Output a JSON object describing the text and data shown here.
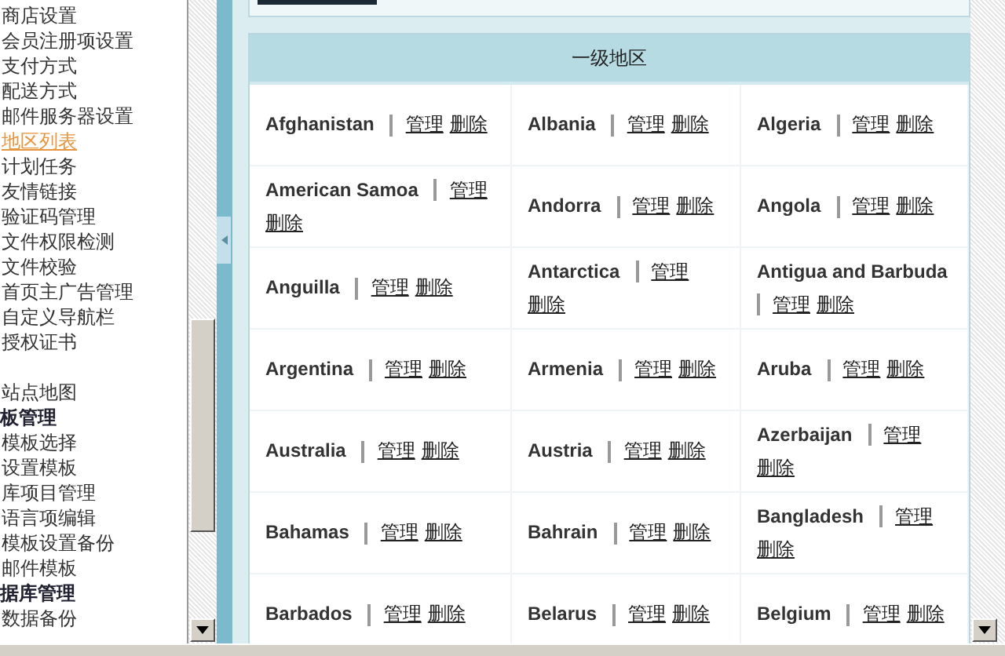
{
  "sidebar": {
    "sections": [
      {
        "items": [
          {
            "label": "商店设置",
            "selected": false
          },
          {
            "label": "会员注册项设置",
            "selected": false
          },
          {
            "label": "支付方式",
            "selected": false
          },
          {
            "label": "配送方式",
            "selected": false
          },
          {
            "label": "邮件服务器设置",
            "selected": false
          },
          {
            "label": "地区列表",
            "selected": true
          },
          {
            "label": "计划任务",
            "selected": false
          },
          {
            "label": "友情链接",
            "selected": false
          },
          {
            "label": "验证码管理",
            "selected": false
          },
          {
            "label": "文件权限检测",
            "selected": false
          },
          {
            "label": "文件校验",
            "selected": false
          },
          {
            "label": "首页主广告管理",
            "selected": false
          },
          {
            "label": "自定义导航栏",
            "selected": false
          },
          {
            "label": "授权证书",
            "selected": false
          }
        ]
      },
      {
        "items": [
          {
            "label": "站点地图",
            "selected": false
          }
        ]
      },
      {
        "heading": "板管理",
        "items": [
          {
            "label": "模板选择",
            "selected": false
          },
          {
            "label": "设置模板",
            "selected": false
          },
          {
            "label": "库项目管理",
            "selected": false
          },
          {
            "label": "语言项编辑",
            "selected": false
          },
          {
            "label": "模板设置备份",
            "selected": false
          },
          {
            "label": "邮件模板",
            "selected": false
          }
        ]
      },
      {
        "heading": "据库管理",
        "items": [
          {
            "label": "数据备份",
            "selected": false
          }
        ]
      }
    ]
  },
  "table": {
    "title": "一级地区",
    "rows": [
      [
        {
          "name": "Afghanistan",
          "manage": "管理",
          "delete": "删除"
        },
        {
          "name": "Albania",
          "manage": "管理",
          "delete": "删除"
        },
        {
          "name": "Algeria",
          "manage": "管理",
          "delete": "删除"
        }
      ],
      [
        {
          "name": "American Samoa",
          "manage": "管理",
          "delete": "删除"
        },
        {
          "name": "Andorra",
          "manage": "管理",
          "delete": "删除"
        },
        {
          "name": "Angola",
          "manage": "管理",
          "delete": "删除"
        }
      ],
      [
        {
          "name": "Anguilla",
          "manage": "管理",
          "delete": "删除"
        },
        {
          "name": "Antarctica",
          "manage": "管理",
          "delete": "删除"
        },
        {
          "name": "Antigua and Barbuda",
          "manage": "管理",
          "delete": "删除"
        }
      ],
      [
        {
          "name": "Argentina",
          "manage": "管理",
          "delete": "删除"
        },
        {
          "name": "Armenia",
          "manage": "管理",
          "delete": "删除"
        },
        {
          "name": "Aruba",
          "manage": "管理",
          "delete": "删除"
        }
      ],
      [
        {
          "name": "Australia",
          "manage": "管理",
          "delete": "删除"
        },
        {
          "name": "Austria",
          "manage": "管理",
          "delete": "删除"
        },
        {
          "name": "Azerbaijan",
          "manage": "管理",
          "delete": "删除"
        }
      ],
      [
        {
          "name": "Bahamas",
          "manage": "管理",
          "delete": "删除"
        },
        {
          "name": "Bahrain",
          "manage": "管理",
          "delete": "删除"
        },
        {
          "name": "Bangladesh",
          "manage": "管理",
          "delete": "删除"
        }
      ],
      [
        {
          "name": "Barbados",
          "manage": "管理",
          "delete": "删除"
        },
        {
          "name": "Belarus",
          "manage": "管理",
          "delete": "删除"
        },
        {
          "name": "Belgium",
          "manage": "管理",
          "delete": "删除"
        }
      ]
    ]
  }
}
